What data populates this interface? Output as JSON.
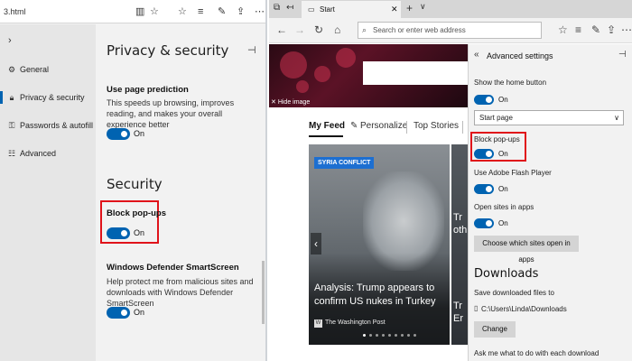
{
  "left": {
    "address_bar": {
      "url": "3.html"
    },
    "nav": [
      {
        "label": "General",
        "icon": "gear-icon"
      },
      {
        "label": "Privacy & security",
        "icon": "lock-icon",
        "active": true
      },
      {
        "label": "Passwords & autofill",
        "icon": "key-icon"
      },
      {
        "label": "Advanced",
        "icon": "sliders-icon"
      }
    ],
    "title": "Privacy & security",
    "page_prediction": {
      "title": "Use page prediction",
      "desc": "This speeds up browsing, improves reading, and makes your overall experience better",
      "state": "On"
    },
    "security_title": "Security",
    "block_popups": {
      "title": "Block pop-ups",
      "state": "On"
    },
    "smartscreen": {
      "title": "Windows Defender SmartScreen",
      "desc": "Help protect me from malicious sites and downloads with Windows Defender SmartScreen",
      "state": "On"
    }
  },
  "right": {
    "tab_label": "Start",
    "omnibox_placeholder": "Search or enter web address",
    "hide_image": "Hide image",
    "feed_tabs": [
      "My Feed",
      "Personalize",
      "Top Stories"
    ],
    "card": {
      "badge": "SYRIA CONFLICT",
      "headline": "Analysis: Trump appears to confirm US nukes in Turkey",
      "source": "The Washington Post"
    },
    "card_peek": [
      "Tr",
      "oth",
      "Tr",
      "Er"
    ],
    "advanced": {
      "title": "Advanced settings",
      "home_button": {
        "label": "Show the home button",
        "state": "On"
      },
      "home_select": "Start page",
      "block_popups": {
        "label": "Block pop-ups",
        "state": "On"
      },
      "flash": {
        "label": "Use Adobe Flash Player",
        "state": "On"
      },
      "open_in_apps": {
        "label": "Open sites in apps",
        "state": "On"
      },
      "choose_button": "Choose which sites open in apps",
      "downloads_title": "Downloads",
      "save_label": "Save downloaded files to",
      "save_path": "C:\\Users\\Linda\\Downloads",
      "change_button": "Change",
      "ask_label": "Ask me what to do with each download"
    }
  },
  "colors": {
    "accent": "#0063b1",
    "highlight": "#e0131a"
  }
}
